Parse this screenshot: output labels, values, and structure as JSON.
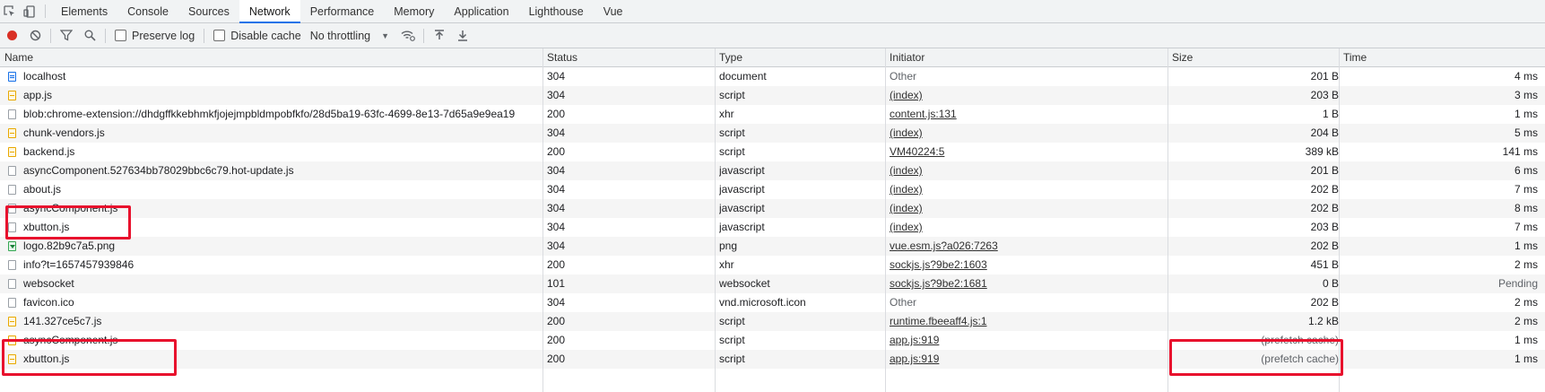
{
  "tabs": [
    "Elements",
    "Console",
    "Sources",
    "Network",
    "Performance",
    "Memory",
    "Application",
    "Lighthouse",
    "Vue"
  ],
  "active_tab": "Network",
  "toolbar": {
    "preserve_log": "Preserve log",
    "disable_cache": "Disable cache",
    "throttling": "No throttling"
  },
  "columns": {
    "name": "Name",
    "status": "Status",
    "type": "Type",
    "initiator": "Initiator",
    "size": "Size",
    "time": "Time"
  },
  "rows": [
    {
      "name": "localhost",
      "status": "304",
      "type": "document",
      "initiator": "Other",
      "size": "201 B",
      "time": "4 ms",
      "icon": "doc",
      "link": false
    },
    {
      "name": "app.js",
      "status": "304",
      "type": "script",
      "initiator": "(index)",
      "size": "203 B",
      "time": "3 ms",
      "icon": "script",
      "link": true
    },
    {
      "name": "blob:chrome-extension://dhdgffkkebhmkfjojejmpbldmpobfkfo/28d5ba19-63fc-4699-8e13-7d65a9e9ea19",
      "status": "200",
      "type": "xhr",
      "initiator": "content.js:131",
      "size": "1 B",
      "time": "1 ms",
      "icon": "file",
      "link": true
    },
    {
      "name": "chunk-vendors.js",
      "status": "304",
      "type": "script",
      "initiator": "(index)",
      "size": "204 B",
      "time": "5 ms",
      "icon": "script",
      "link": true
    },
    {
      "name": "backend.js",
      "status": "200",
      "type": "script",
      "initiator": "VM40224:5",
      "size": "389 kB",
      "time": "141 ms",
      "icon": "script",
      "link": true
    },
    {
      "name": "asyncComponent.527634bb78029bbc6c79.hot-update.js",
      "status": "304",
      "type": "javascript",
      "initiator": "(index)",
      "size": "201 B",
      "time": "6 ms",
      "icon": "file",
      "link": true
    },
    {
      "name": "about.js",
      "status": "304",
      "type": "javascript",
      "initiator": "(index)",
      "size": "202 B",
      "time": "7 ms",
      "icon": "file",
      "link": true
    },
    {
      "name": "asyncComponent.js",
      "status": "304",
      "type": "javascript",
      "initiator": "(index)",
      "size": "202 B",
      "time": "8 ms",
      "icon": "file",
      "link": true
    },
    {
      "name": "xbutton.js",
      "status": "304",
      "type": "javascript",
      "initiator": "(index)",
      "size": "203 B",
      "time": "7 ms",
      "icon": "file",
      "link": true
    },
    {
      "name": "logo.82b9c7a5.png",
      "status": "304",
      "type": "png",
      "initiator": "vue.esm.js?a026:7263",
      "size": "202 B",
      "time": "1 ms",
      "icon": "image",
      "link": true
    },
    {
      "name": "info?t=1657457939846",
      "status": "200",
      "type": "xhr",
      "initiator": "sockjs.js?9be2:1603",
      "size": "451 B",
      "time": "2 ms",
      "icon": "file",
      "link": true
    },
    {
      "name": "websocket",
      "status": "101",
      "type": "websocket",
      "initiator": "sockjs.js?9be2:1681",
      "size": "0 B",
      "time": "Pending",
      "icon": "file",
      "link": true
    },
    {
      "name": "favicon.ico",
      "status": "304",
      "type": "vnd.microsoft.icon",
      "initiator": "Other",
      "size": "202 B",
      "time": "2 ms",
      "icon": "file",
      "link": false
    },
    {
      "name": "141.327ce5c7.js",
      "status": "200",
      "type": "script",
      "initiator": "runtime.fbeeaff4.js:1",
      "size": "1.2 kB",
      "time": "2 ms",
      "icon": "script",
      "link": true
    },
    {
      "name": "asyncComponent.js",
      "status": "200",
      "type": "script",
      "initiator": "app.js:919",
      "size": "(prefetch cache)",
      "time": "1 ms",
      "icon": "script",
      "link": true
    },
    {
      "name": "xbutton.js",
      "status": "200",
      "type": "script",
      "initiator": "app.js:919",
      "size": "(prefetch cache)",
      "time": "1 ms",
      "icon": "script",
      "link": true
    }
  ],
  "colors": {
    "accent": "#1a73e8",
    "record": "#d93025",
    "highlight": "#e8112d"
  }
}
